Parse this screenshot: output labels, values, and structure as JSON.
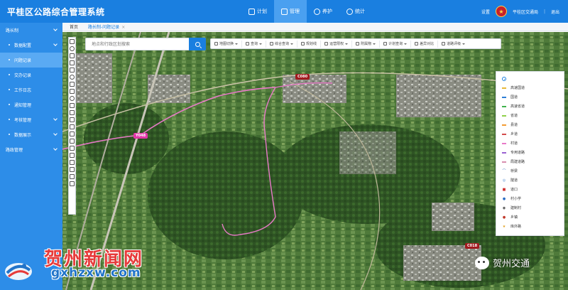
{
  "header": {
    "app_title": "平桂区公路综合管理系统",
    "nav": [
      {
        "label": "计划",
        "active": false
      },
      {
        "label": "管理",
        "active": true
      },
      {
        "label": "养护",
        "active": false
      },
      {
        "label": "统计",
        "active": false
      }
    ],
    "settings_label": "设置",
    "user_name": "平桂区交通局",
    "logout_label": "退出"
  },
  "sidebar": {
    "items": [
      {
        "label": "路长制",
        "level": 0,
        "expandable": true
      },
      {
        "label": "数据配置",
        "level": 1,
        "expandable": true
      },
      {
        "label": "问题记录",
        "level": 1,
        "active": true
      },
      {
        "label": "交办记录",
        "level": 1
      },
      {
        "label": "工作日志",
        "level": 1
      },
      {
        "label": "通知管理",
        "level": 1
      },
      {
        "label": "考核管理",
        "level": 1,
        "expandable": true
      },
      {
        "label": "数据展示",
        "level": 1,
        "expandable": true
      },
      {
        "label": "路政管理",
        "level": 0,
        "expandable": true
      }
    ]
  },
  "tabs": {
    "home": "首页",
    "current": "路长制-问题记录",
    "close": "×"
  },
  "search": {
    "placeholder": "地点和行政区划搜索"
  },
  "map_tools": [
    {
      "label": "地图切换"
    },
    {
      "label": "查询"
    },
    {
      "label": "综合查询"
    },
    {
      "label": "规划线"
    },
    {
      "label": "运营限权"
    },
    {
      "label": "附属物"
    },
    {
      "label": "计划查询"
    },
    {
      "label": "差异对比"
    },
    {
      "label": "道路评级"
    }
  ],
  "legend": {
    "items": [
      {
        "label": "高速国道",
        "color": "#e8b93a",
        "kind": "line"
      },
      {
        "label": "国道",
        "color": "#2e7fd6",
        "kind": "line"
      },
      {
        "label": "高速省道",
        "color": "#3fb24c",
        "kind": "line"
      },
      {
        "label": "省道",
        "color": "#8fd04a",
        "kind": "line"
      },
      {
        "label": "县道",
        "color": "#f39c33",
        "kind": "line"
      },
      {
        "label": "乡道",
        "color": "#d44b4b",
        "kind": "line"
      },
      {
        "label": "村道",
        "color": "#e87ac8",
        "kind": "line"
      },
      {
        "label": "专用道路",
        "color": "#9a62d2",
        "kind": "line"
      },
      {
        "label": "局建道路",
        "color": "#d88faf",
        "kind": "line"
      },
      {
        "label": "桥梁",
        "color": "#3068b8",
        "kind": "bridge-icon"
      },
      {
        "label": "隧道",
        "color": "#4a8ad0",
        "kind": "tunnel-icon"
      },
      {
        "label": "道口",
        "color": "#d03030",
        "kind": "crossing-icon"
      },
      {
        "label": "村小学",
        "color": "#2b6ec4",
        "kind": "school-icon"
      },
      {
        "label": "建制村",
        "color": "#3d3d3d",
        "kind": "village-icon"
      },
      {
        "label": "乡镇",
        "color": "#c0392b",
        "kind": "town-icon"
      },
      {
        "label": "库外路",
        "color": "#e0a020",
        "kind": "star-icon"
      }
    ]
  },
  "markers": [
    {
      "label": "C080",
      "style": "red"
    },
    {
      "label": "Y048",
      "style": "pink"
    },
    {
      "label": "C018",
      "style": "red"
    }
  ],
  "watermark": {
    "cn": "贺州新闻网",
    "en": "gxhzxw.com",
    "wechat": "贺州交通"
  },
  "colors": {
    "header": "#1a7fe0",
    "sidebar": "#2d8de8",
    "village_road": "#e87ac8"
  }
}
